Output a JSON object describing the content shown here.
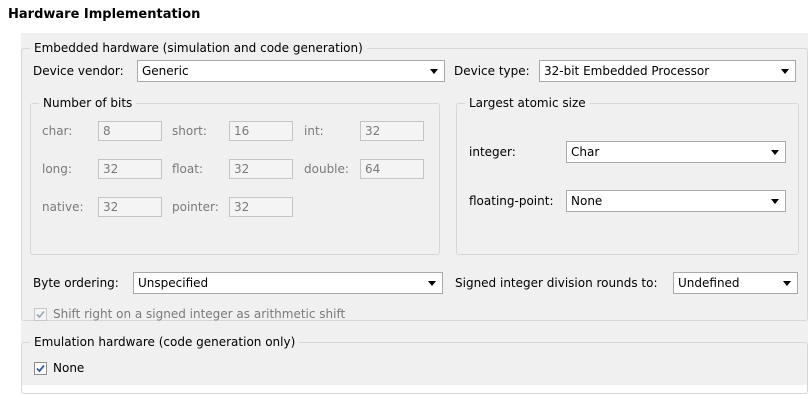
{
  "title": "Hardware Implementation",
  "embedded": {
    "legend": "Embedded hardware (simulation and code generation)",
    "device_vendor_label": "Device vendor:",
    "device_vendor_value": "Generic",
    "device_type_label": "Device type:",
    "device_type_value": "32-bit Embedded Processor",
    "bits": {
      "legend": "Number of bits",
      "char_label": "char:",
      "char_value": "8",
      "short_label": "short:",
      "short_value": "16",
      "int_label": "int:",
      "int_value": "32",
      "long_label": "long:",
      "long_value": "32",
      "float_label": "float:",
      "float_value": "32",
      "double_label": "double:",
      "double_value": "64",
      "native_label": "native:",
      "native_value": "32",
      "pointer_label": "pointer:",
      "pointer_value": "32"
    },
    "atomic": {
      "legend": "Largest atomic size",
      "integer_label": "integer:",
      "integer_value": "Char",
      "float_label": "floating-point:",
      "float_value": "None"
    },
    "byte_order_label": "Byte ordering:",
    "byte_order_value": "Unspecified",
    "division_label": "Signed integer division rounds to:",
    "division_value": "Undefined",
    "shift_label": "Shift right on a signed integer as arithmetic shift",
    "shift_checked": true
  },
  "emulation": {
    "legend": "Emulation hardware (code generation only)",
    "none_label": "None",
    "none_checked": true
  },
  "icons": {
    "dropdown": "chevron-down-icon",
    "check": "checkmark-icon"
  },
  "colors": {
    "panel": "#f0f0f0",
    "check_mark": "#3b5a9a",
    "disabled_text": "#7a7a7a"
  }
}
